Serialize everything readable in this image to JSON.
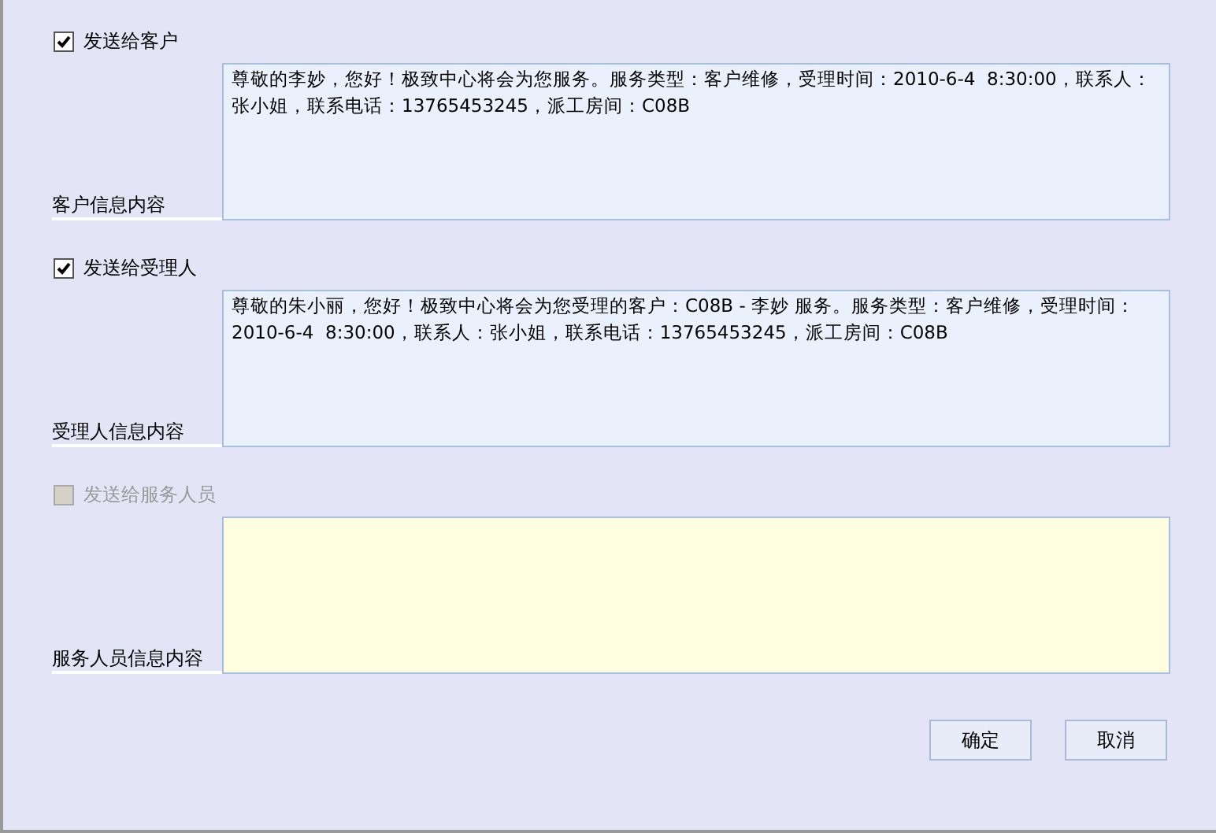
{
  "sections": [
    {
      "checkbox": {
        "label": "发送给客户",
        "checked": true,
        "disabled": false
      },
      "field_label": "客户信息内容",
      "message": "尊敬的李妙，您好！极致中心将会为您服务。服务类型：客户维修，受理时间：2010-6-4  8:30:00，联系人：张小姐，联系电话：13765453245，派工房间：C08B",
      "editable": true
    },
    {
      "checkbox": {
        "label": "发送给受理人",
        "checked": true,
        "disabled": false
      },
      "field_label": "受理人信息内容",
      "message": "尊敬的朱小丽，您好！极致中心将会为您受理的客户：C08B - 李妙 服务。服务类型：客户维修，受理时间：2010-6-4  8:30:00，联系人：张小姐，联系电话：13765453245，派工房间：C08B",
      "editable": true
    },
    {
      "checkbox": {
        "label": "发送给服务人员",
        "checked": false,
        "disabled": true
      },
      "field_label": "服务人员信息内容",
      "editable": false
    }
  ],
  "buttons": [
    "确定",
    "取消"
  ]
}
